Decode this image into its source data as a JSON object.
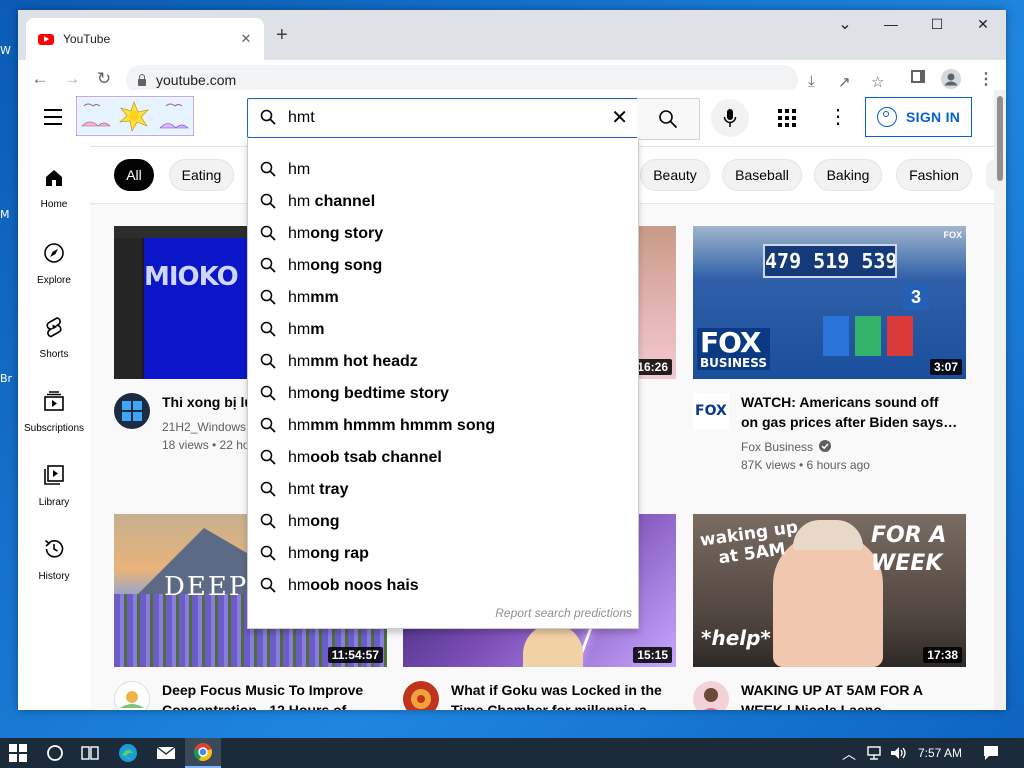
{
  "desktop": {
    "edge_letters": [
      "W",
      "M",
      "Br"
    ]
  },
  "browser": {
    "tab_title": "YouTube",
    "tab_close": "✕",
    "new_tab": "+",
    "url": "youtube.com",
    "window_controls": {
      "minimize": "—",
      "maximize": "☐",
      "close": "✕",
      "tabsearch": "⌄"
    }
  },
  "youtube": {
    "search": {
      "query": "hmt",
      "clear": "✕"
    },
    "sign_in_label": "SIGN IN",
    "guide": [
      {
        "label": "Home",
        "icon": "home-icon"
      },
      {
        "label": "Explore",
        "icon": "compass-icon"
      },
      {
        "label": "Shorts",
        "icon": "shorts-icon"
      },
      {
        "label": "Subscriptions",
        "icon": "subscriptions-icon"
      },
      {
        "label": "Library",
        "icon": "library-icon"
      },
      {
        "label": "History",
        "icon": "history-icon"
      }
    ],
    "chips": [
      "All",
      "Eating",
      "Beauty",
      "Baseball",
      "Baking",
      "Fashion"
    ],
    "suggestions": [
      {
        "prefix": "hm",
        "rest": ""
      },
      {
        "prefix": "hm",
        "rest": " channel"
      },
      {
        "prefix": "hm",
        "rest": "ong story"
      },
      {
        "prefix": "hm",
        "rest": "ong song"
      },
      {
        "prefix": "hm",
        "rest": "mm"
      },
      {
        "prefix": "hm",
        "rest": "m"
      },
      {
        "prefix": "hm",
        "rest": "mm hot headz"
      },
      {
        "prefix": "hm",
        "rest": "ong bedtime story"
      },
      {
        "prefix": "hm",
        "rest": "mm hmmm hmmm song"
      },
      {
        "prefix": "hm",
        "rest": "oob tsab channel"
      },
      {
        "prefix": "hmt",
        "rest": " tray"
      },
      {
        "prefix": "hm",
        "rest": "ong"
      },
      {
        "prefix": "hm",
        "rest": "ong rap"
      },
      {
        "prefix": "hm",
        "rest": "oob noos hais"
      }
    ],
    "report_label": "Report search predictions",
    "videos": [
      {
        "title1": "Thi xong bị lú",
        "title2": "",
        "channel": "21H2_Windows",
        "meta": "18 views • 22 ho",
        "duration": ""
      },
      {
        "title1": "",
        "title2": "",
        "channel": "",
        "meta": "",
        "duration": "16:26"
      },
      {
        "title1": "WATCH: Americans sound off",
        "title2": "on gas prices after Biden says…",
        "channel": "Fox Business",
        "meta": "87K views • 6 hours ago",
        "duration": "3:07"
      },
      {
        "title1": "Deep Focus Music To Improve",
        "title2": "Concentration - 12 Hours of",
        "channel": "",
        "meta": "",
        "duration": "11:54:57"
      },
      {
        "title1": "What if Goku was Locked in the",
        "title2": "Time Chamber for millennia a",
        "channel": "",
        "meta": "",
        "duration": "15:15"
      },
      {
        "title1": "WAKING UP AT 5AM FOR A",
        "title2": "WEEK | Nicole Laeno",
        "channel": "",
        "meta": "",
        "duration": "17:38"
      }
    ],
    "thumb_text": {
      "mioko": "MIOKO",
      "gas_price": "479 519 539",
      "pump_no": "3",
      "fox1": "FOX",
      "fox2": "BUSINESS",
      "fox_corner": "FOX",
      "deep": "DEEP",
      "wake1": "waking up",
      "wake2": "at 5AM",
      "week1": "FOR A",
      "week2": "WEEK",
      "help": "*help*",
      "fox_avatar": "FOX"
    }
  },
  "taskbar": {
    "time": "7:57 AM"
  }
}
